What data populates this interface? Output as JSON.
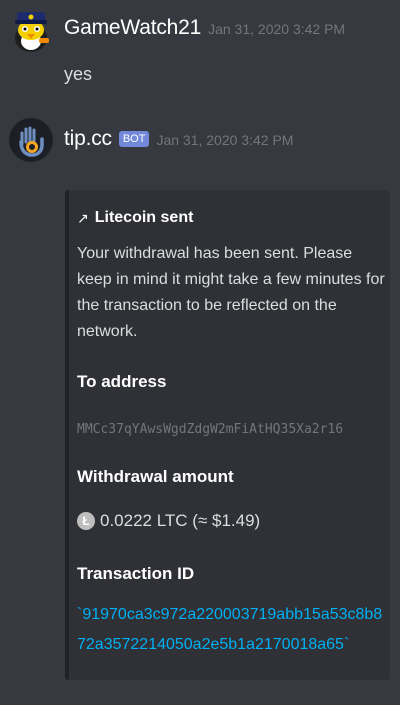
{
  "messages": [
    {
      "username": "GameWatch21",
      "timestamp": "Jan 31, 2020 3:42 PM",
      "text": "yes",
      "avatar_icon": "penguin-icon"
    },
    {
      "username": "tip.cc",
      "badge": "BOT",
      "timestamp": "Jan 31, 2020 3:42 PM",
      "avatar_icon": "tipcc-hand-icon",
      "embed": {
        "author_icon": "arrow-up-icon",
        "author": "Litecoin sent",
        "description": "Your withdrawal has been sent. Please keep in mind it might take a few minutes for the transaction to be reflected on the network.",
        "fields": {
          "to_address": {
            "name": "To address",
            "value": "MMCc37qYAwsWgdZdgW2mFiAtHQ35Xa2r16"
          },
          "withdrawal_amount": {
            "name": "Withdrawal amount",
            "coin_icon": "litecoin-icon",
            "coin_symbol": "Ł",
            "value": "0.0222 LTC (≈ $1.49)"
          },
          "transaction_id": {
            "name": "Transaction ID",
            "value": "`91970ca3c972a220003719abb15a53c8b872a3572214050a2e5b1a2170018a65`"
          }
        }
      }
    }
  ],
  "colors": {
    "background": "#36393f",
    "embed_background": "#2f3136",
    "bot_badge": "#7289da",
    "link": "#00b0f4"
  }
}
